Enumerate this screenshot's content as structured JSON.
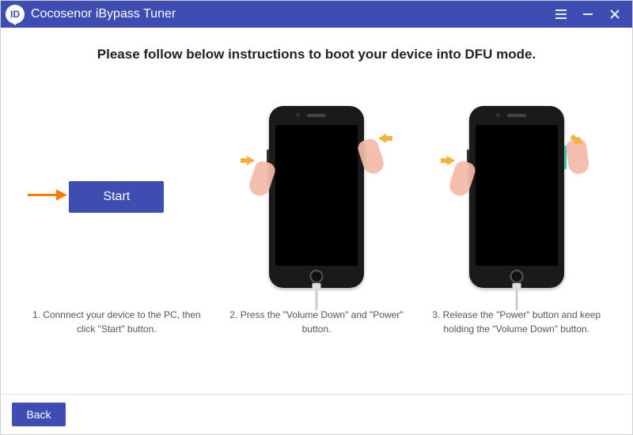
{
  "app": {
    "title": "Cocosenor iBypass Tuner",
    "logo_text": "ID"
  },
  "main": {
    "heading": "Please follow below instructions to boot your device into DFU mode.",
    "start_label": "Start",
    "steps": {
      "s1": "1. Connnect your device to the PC, then click \"Start\" button.",
      "s2": "2. Press the \"Volume Down\" and \"Power\" button.",
      "s3": "3. Release the \"Power\" button and keep holding the \"Volume Down\" button."
    }
  },
  "footer": {
    "back_label": "Back"
  },
  "colors": {
    "brand": "#3e4db2",
    "accent_arrow": "#ff7a00"
  }
}
